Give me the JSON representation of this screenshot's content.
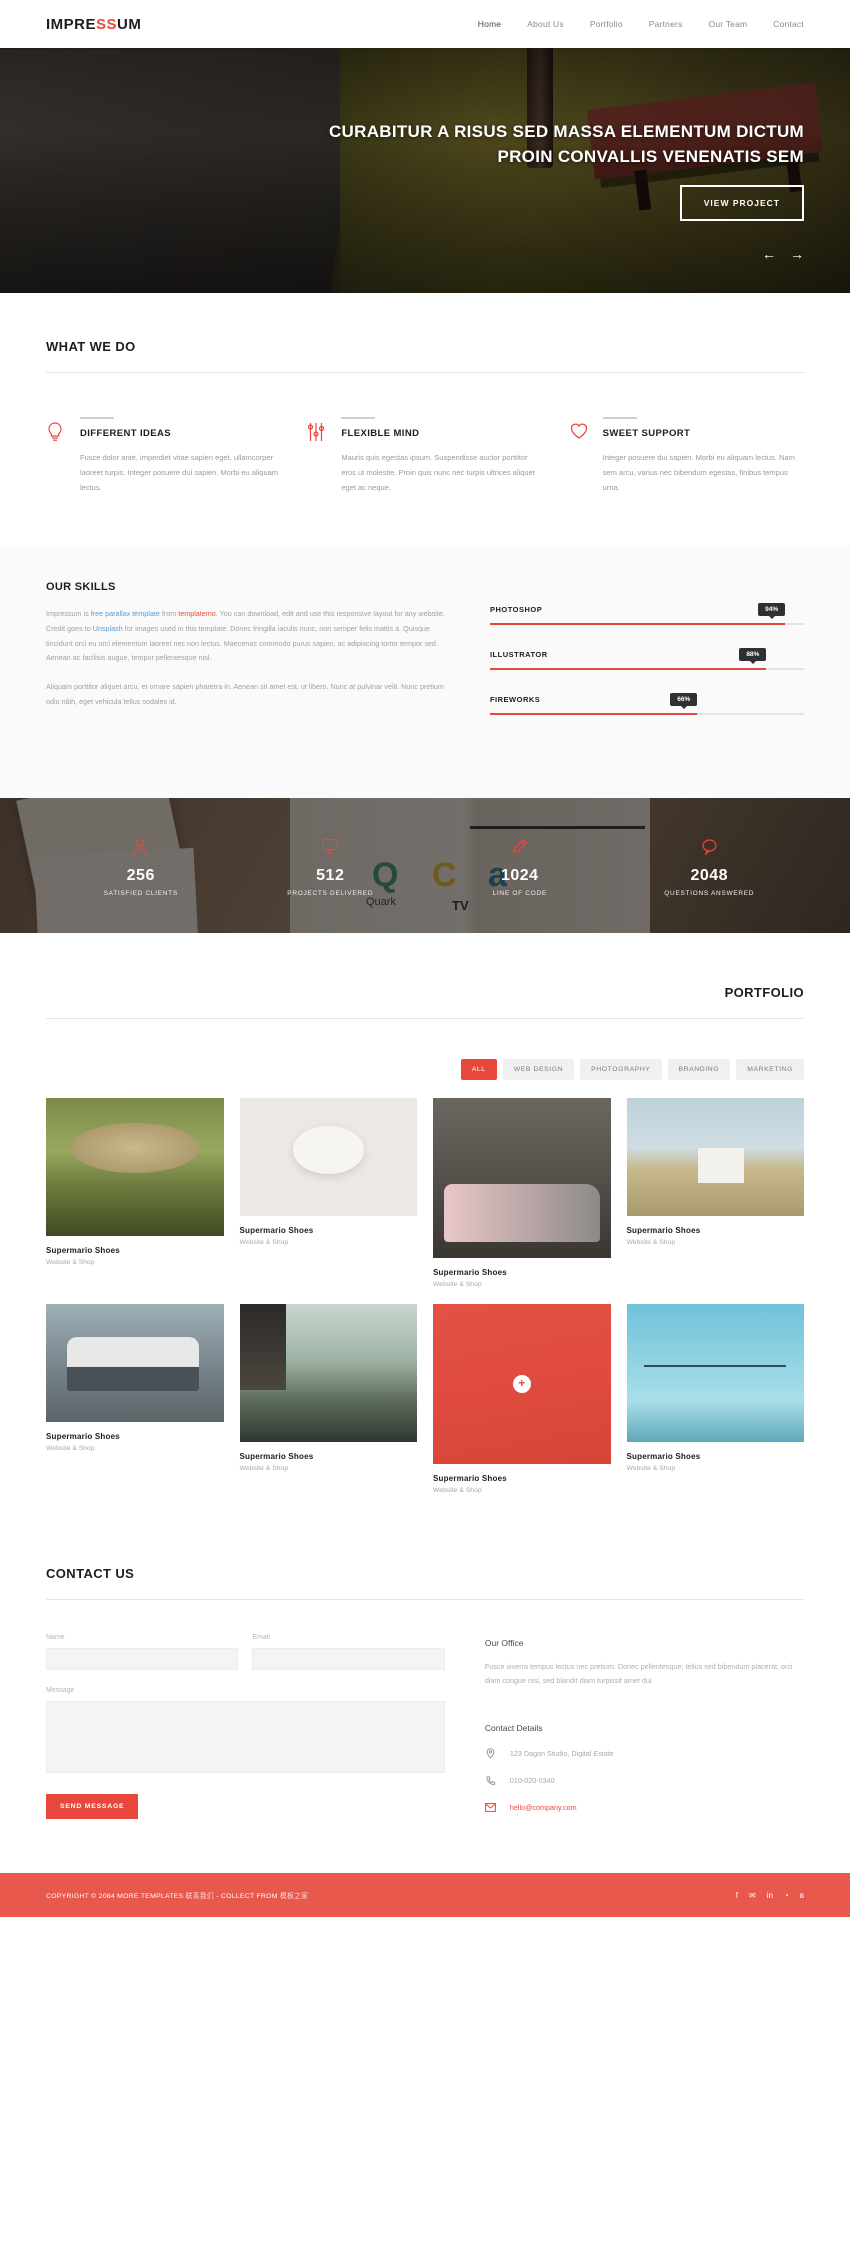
{
  "header": {
    "logo_main_1": "IMPRE",
    "logo_accent": "SS",
    "logo_main_2": "UM",
    "nav": [
      {
        "label": "Home"
      },
      {
        "label": "About Us"
      },
      {
        "label": "Portfolio"
      },
      {
        "label": "Partners"
      },
      {
        "label": "Our Team"
      },
      {
        "label": "Contact"
      }
    ]
  },
  "hero": {
    "title_line1": "CURABITUR A RISUS SED MASSA ELEMENTUM DICTUM",
    "title_line2": "PROIN CONVALLIS VENENATIS SEM",
    "cta": "VIEW PROJECT",
    "prev_arrow": "←",
    "next_arrow": "→"
  },
  "what_we_do": {
    "title": "WHAT WE DO",
    "features": [
      {
        "icon": "lightbulb-icon",
        "title": "DIFFERENT IDEAS",
        "text": "Fusce dolor ante, imperdiet vitae sapien eget, ullamcorper laoreet turpis. Integer posuere dui sapien. Morbi eu aliquam lectus."
      },
      {
        "icon": "sliders-icon",
        "title": "FLEXIBLE MIND",
        "text": "Mauris quis egestas ipsum. Suspendisse auctor porttitor eros ut molestie. Proin quis nunc nec turpis ultrices aliquet eget ac neque."
      },
      {
        "icon": "heart-icon",
        "title": "SWEET SUPPORT",
        "text": "Integer posuere dui sapien. Morbi eu aliquam lectus. Nam sem arcu, varius nec bibendum egestas, finibus tempus urna."
      }
    ]
  },
  "skills": {
    "title": "OUR SKILLS",
    "para_1": "Impressum is ",
    "link_1": "free parallax template",
    "para_2": " from ",
    "link_2": "templatemo",
    "para_3": ". You can download, edit and use this responsive layout for any website. Credit goes to ",
    "link_3": "Unsplash",
    "para_4": " for images used in this template. Donec fringilla iaculis nunc, non semper felis mattis a. Quisque tincidunt orci eu orci elementum laoreet nec non lectus. Maecenas commodo purus sapien, ac adipiscing tortor tempor sed. Aenean ac facilisis augue, tempor pellentesque nisl.",
    "para_5": "Aliquam porttitor aliquet arcu, et ornare sapien pharetra in. Aenean sit amet est, ut libero. Nunc at pulvinar velit. Nunc pretium odio nibh, eget vehicula tellus sodales id.",
    "bars": [
      {
        "name": "PHOTOSHOP",
        "value": "94%",
        "pct": 94
      },
      {
        "name": "ILLUSTRATOR",
        "value": "88%",
        "pct": 88
      },
      {
        "name": "FIREWORKS",
        "value": "66%",
        "pct": 66
      }
    ]
  },
  "counters": [
    {
      "icon": "user-icon",
      "number": "256",
      "label": "SATISFIED CLIENTS"
    },
    {
      "icon": "monitor-icon",
      "number": "512",
      "label": "PROJECTS DELIVERED"
    },
    {
      "icon": "pencil-icon",
      "number": "1024",
      "label": "LINE OF CODE"
    },
    {
      "icon": "speech-bubble-icon",
      "number": "2048",
      "label": "QUESTIONS ANSWERED"
    }
  ],
  "portfolio": {
    "title": "PORTFOLIO",
    "filters": [
      {
        "label": "ALL",
        "active": true
      },
      {
        "label": "WEB DESIGN",
        "active": false
      },
      {
        "label": "PHOTOGRAPHY",
        "active": false
      },
      {
        "label": "BRANDING",
        "active": false
      },
      {
        "label": "MARKETING",
        "active": false
      }
    ],
    "items": [
      {
        "title": "Supermario Shoes",
        "subtitle": "Website & Shop"
      },
      {
        "title": "Supermario Shoes",
        "subtitle": "Website & Shop"
      },
      {
        "title": "Supermario Shoes",
        "subtitle": "Website & Shop"
      },
      {
        "title": "Supermario Shoes",
        "subtitle": "Website & Shop"
      },
      {
        "title": "Supermario Shoes",
        "subtitle": "Website & Shop"
      },
      {
        "title": "Supermario Shoes",
        "subtitle": "Website & Shop"
      },
      {
        "title": "Supermario Shoes",
        "subtitle": "Website & Shop"
      },
      {
        "title": "Supermario Shoes",
        "subtitle": "Website & Shop"
      }
    ],
    "overlay_plus": "+"
  },
  "contact": {
    "title": "CONTACT US",
    "name_label": "Name",
    "email_label": "Email",
    "message_label": "Message",
    "name_value": "",
    "email_value": "",
    "message_value": "",
    "send_label": "SEND MESSAGE",
    "office_heading": "Our Office",
    "office_text": "Fusce viverra tempus lectus nec pretium. Donec pellentesque, tellus sed bibendum placerat, orci diam congue nisi, sed blandit diam turpissit amet dui.",
    "details_heading": "Contact Details",
    "address": "123 Dagon Studio, Digital Estate",
    "phone": "010-020-0340",
    "email": "hello@company.com"
  },
  "footer": {
    "copyright_1": "COPYRIGHT © 2084 MORE TEMPLATES ",
    "link_1": "联系我们",
    "copyright_2": " - COLLECT FROM ",
    "link_2": "模板之家",
    "social": [
      {
        "icon": "facebook-icon",
        "glyph": "f"
      },
      {
        "icon": "twitter-icon",
        "glyph": "✉"
      },
      {
        "icon": "linkedin-icon",
        "glyph": "in"
      },
      {
        "icon": "rss-icon",
        "glyph": "◔"
      },
      {
        "icon": "behance-icon",
        "glyph": "в"
      }
    ]
  },
  "colors": {
    "accent": "#e8473c",
    "dark": "#2e3033",
    "muted": "#a8a8a8"
  }
}
